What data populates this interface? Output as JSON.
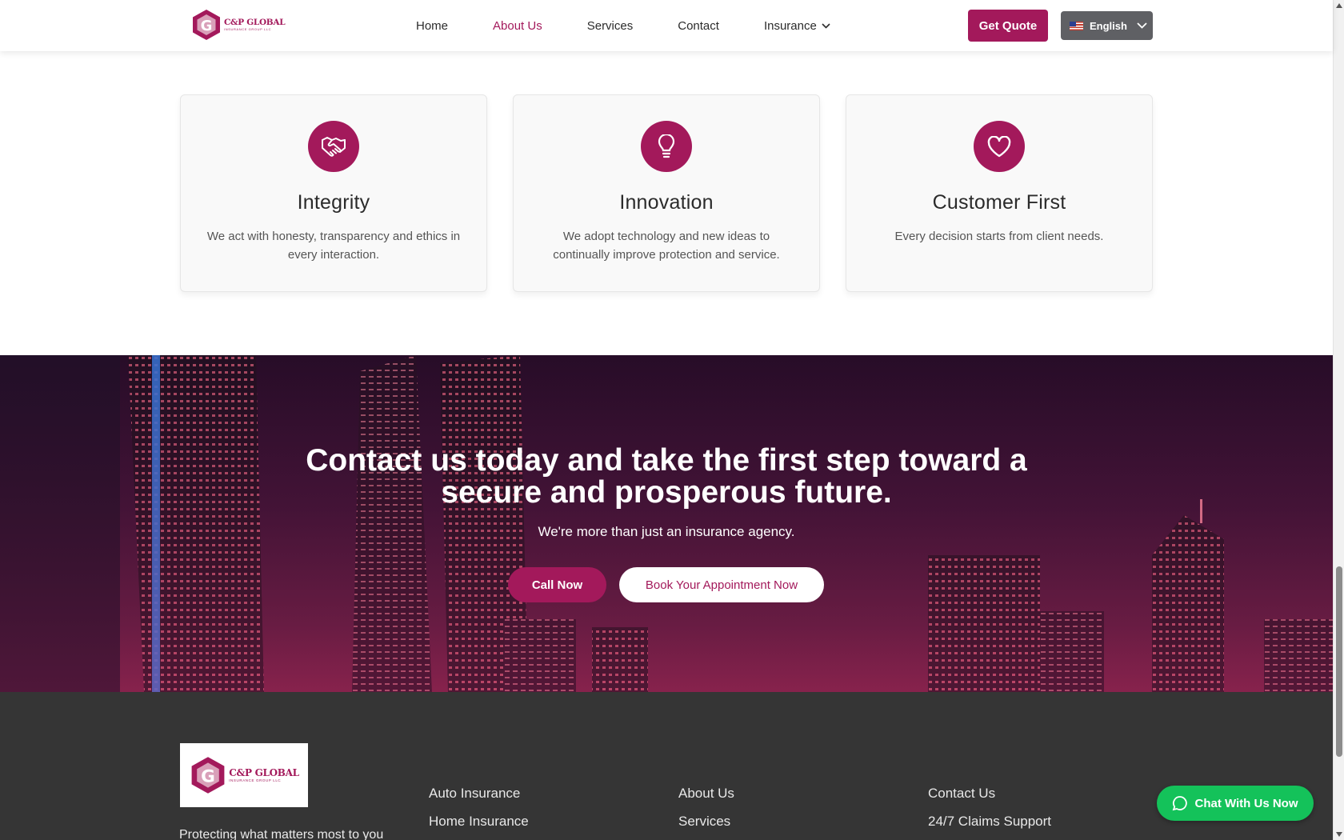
{
  "header": {
    "logo": {
      "name": "C&P GLOBAL",
      "tagline": "INSURANCE GROUP LLC"
    },
    "nav": [
      {
        "label": "Home"
      },
      {
        "label": "About Us"
      },
      {
        "label": "Services"
      },
      {
        "label": "Contact"
      },
      {
        "label": "Insurance"
      }
    ],
    "active_nav": "About Us",
    "quote_button": "Get Quote",
    "language": "English"
  },
  "values": [
    {
      "title": "Integrity",
      "text": "We act with honesty, transparency and ethics in every interaction.",
      "icon": "handshake-icon"
    },
    {
      "title": "Innovation",
      "text": "We adopt technology and new ideas to continually improve protection and service.",
      "icon": "lightbulb-icon"
    },
    {
      "title": "Customer First",
      "text": "Every decision starts from client needs.",
      "icon": "heart-icon"
    }
  ],
  "cta": {
    "title_line1": "Contact us today and take the first step toward a",
    "title_line2": "secure and prosperous future.",
    "subtitle": "We're more than just an insurance agency.",
    "call_button": "Call Now",
    "book_button": "Book Your Appointment Now"
  },
  "footer": {
    "logo": {
      "name": "C&P GLOBAL",
      "tagline": "INSURANCE GROUP LLC"
    },
    "tagline": "Protecting what matters most to you",
    "col1": [
      "Auto Insurance",
      "Home Insurance"
    ],
    "col2": [
      "About Us",
      "Services"
    ],
    "col3": [
      "Contact Us",
      "24/7 Claims Support"
    ]
  },
  "chat_button": "Chat With Us Now",
  "colors": {
    "brand": "#a3195b",
    "footer_bg": "#353535",
    "chat": "#14c25a"
  }
}
